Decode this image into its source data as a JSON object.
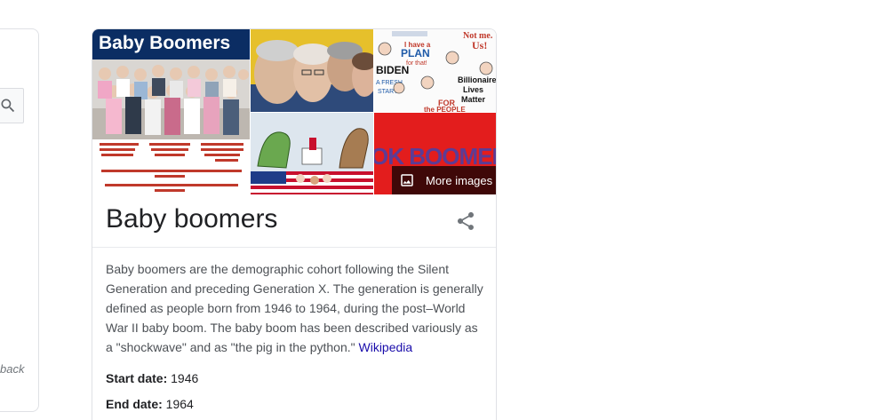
{
  "left_panel": {
    "search_icon": "search-icon",
    "footer_text": "back"
  },
  "knowledge_panel": {
    "images": [
      {
        "title_text": "Baby Boomers"
      },
      {},
      {
        "tag": "BIDEN"
      },
      {},
      {
        "text": "OK BOOMER!"
      }
    ],
    "more_images_label": "More images",
    "title": "Baby boomers",
    "share_icon": "share-icon",
    "description": "Baby boomers are the demographic cohort following the Silent Generation and preceding Generation X. The generation is generally defined as people born from 1946 to 1964, during the post–World War II baby boom. The baby boom has been described variously as a \"shockwave\" and as \"the pig in the python.\"",
    "source_link": "Wikipedia",
    "facts": [
      {
        "label": "Start date:",
        "value": "1946"
      },
      {
        "label": "End date:",
        "value": "1964"
      }
    ]
  }
}
